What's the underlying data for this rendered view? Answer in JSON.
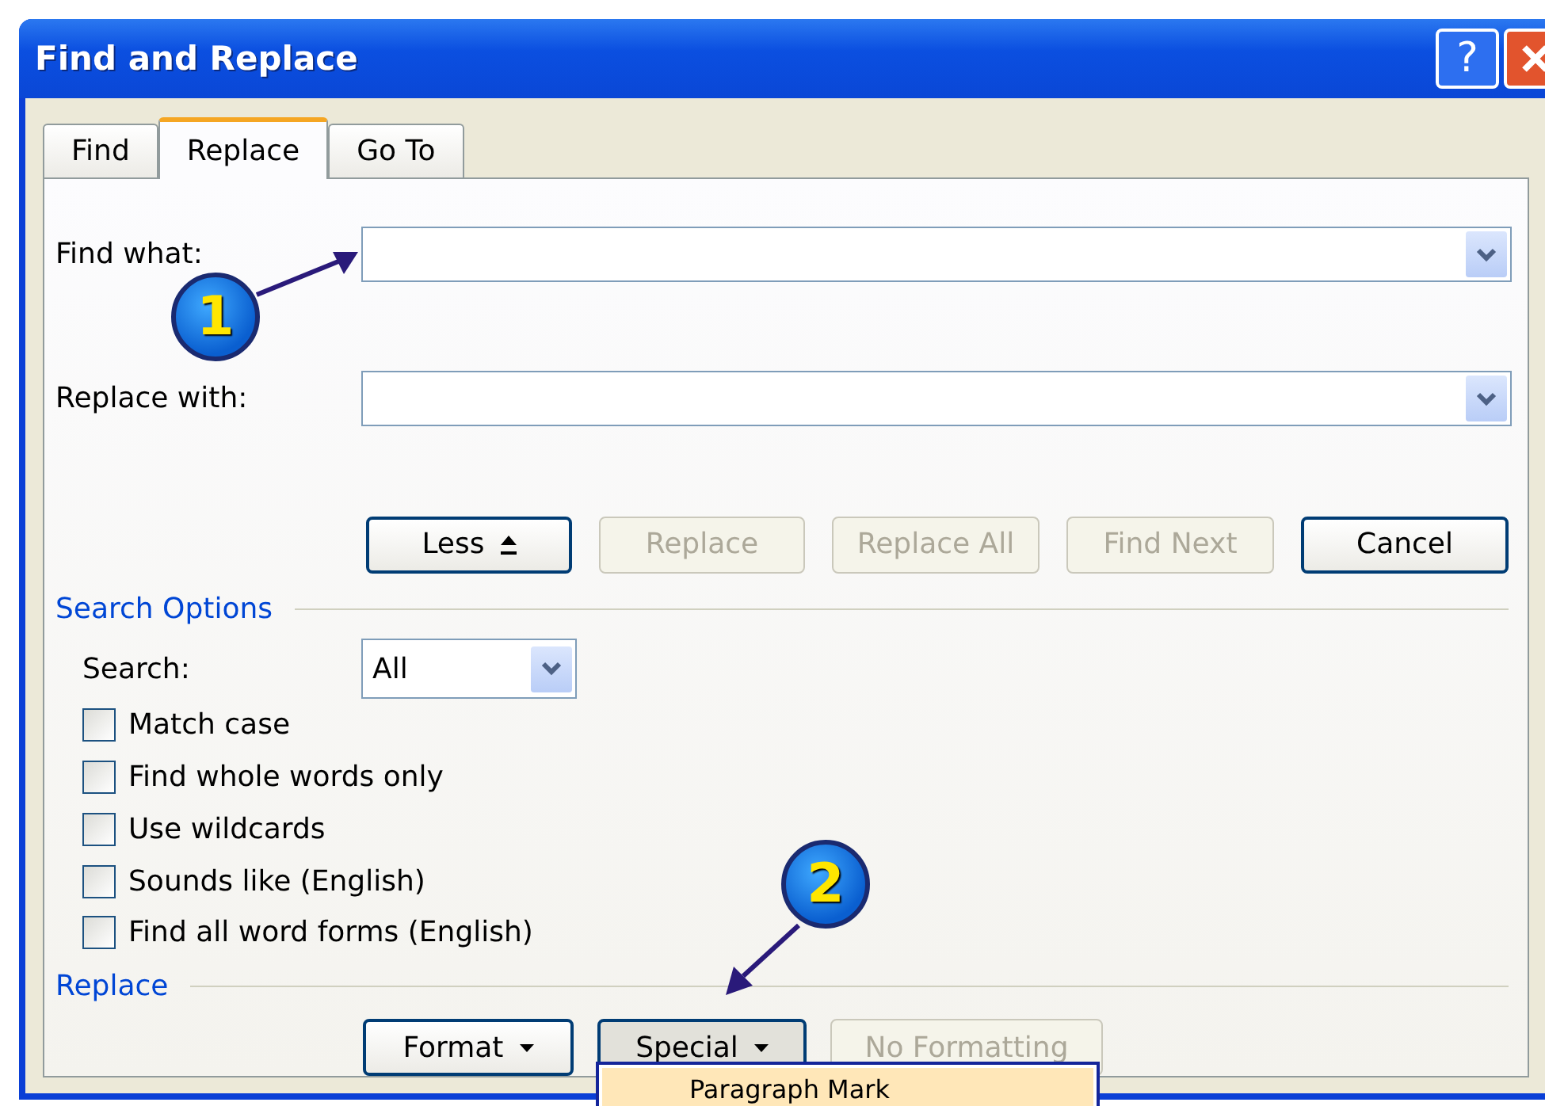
{
  "window": {
    "title": "Find and Replace",
    "help": "?"
  },
  "tabs": [
    {
      "label": "Find",
      "selected": false
    },
    {
      "label": "Replace",
      "selected": true
    },
    {
      "label": "Go To",
      "selected": false
    }
  ],
  "fields": [
    {
      "label": "Find what:"
    },
    {
      "label": "Replace with:"
    }
  ],
  "buttons": [
    {
      "label": "Less",
      "kind": "less",
      "disabled": false
    },
    {
      "label": "Replace",
      "kind": "plain",
      "disabled": true
    },
    {
      "label": "Replace All",
      "kind": "plain",
      "disabled": true
    },
    {
      "label": "Find Next",
      "kind": "plain",
      "disabled": true
    },
    {
      "label": "Cancel",
      "kind": "plain",
      "disabled": false
    }
  ],
  "search_options": {
    "heading": "Search Options",
    "search_label": "Search:",
    "search_value": "All",
    "options": [
      {
        "label": "Match case",
        "checked": false
      },
      {
        "label": "Find whole words only",
        "checked": false
      },
      {
        "label": "Use wildcards",
        "checked": false
      },
      {
        "label": "Sounds like (English)",
        "checked": false
      },
      {
        "label": "Find all word forms (English)",
        "checked": false
      }
    ]
  },
  "replace_section": {
    "heading": "Replace",
    "buttons": [
      {
        "label": "Format",
        "kind": "menu",
        "pressed": false,
        "disabled": false
      },
      {
        "label": "Special",
        "kind": "menu",
        "pressed": true,
        "disabled": false
      },
      {
        "label": "No Formatting",
        "kind": "plain",
        "pressed": false,
        "disabled": true
      }
    ]
  },
  "menu": {
    "items": [
      {
        "label": "Paragraph Mark",
        "selected": true
      }
    ]
  },
  "callouts": [
    {
      "number": "1"
    },
    {
      "number": "2"
    }
  ]
}
